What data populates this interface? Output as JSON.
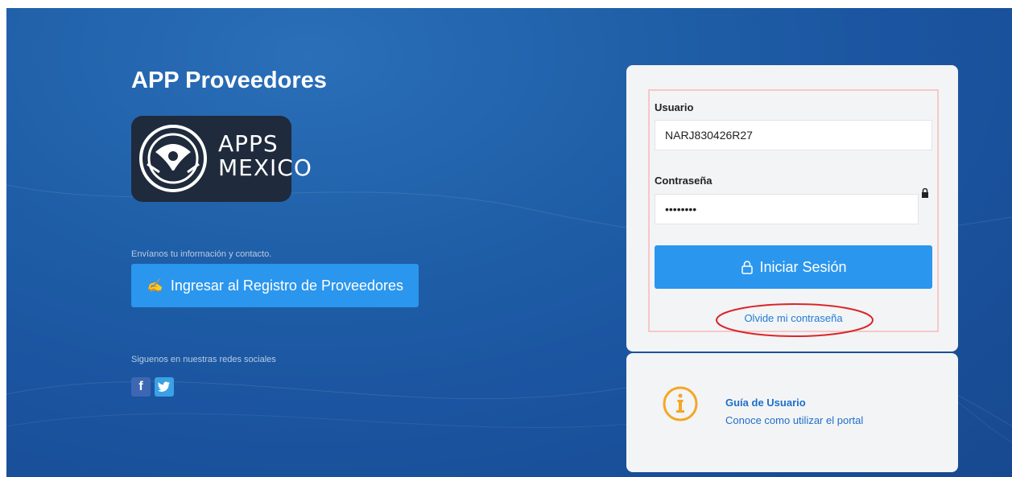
{
  "brand": {
    "app_title": "APP Proveedores",
    "logo_text_line1": "APPS",
    "logo_text_line2": "MEXICO"
  },
  "left": {
    "contact_text": "Envíanos tu información y contacto.",
    "register_button_label": "Ingresar al Registro de Proveedores",
    "social_text": "Siguenos en nuestras redes sociales",
    "social_icons": [
      "facebook-icon",
      "twitter-icon"
    ]
  },
  "login": {
    "user_label": "Usuario",
    "user_value": "NARJ830426R27",
    "password_label": "Contraseña",
    "password_value": "••••••••",
    "submit_label": "Iniciar Sesión",
    "forgot_label": "Olvide mi contraseña"
  },
  "guide": {
    "title": "Guía de Usuario",
    "subtitle": "Conoce como utilizar el portal",
    "icon": "info-icon"
  },
  "colors": {
    "background": "#1f5fa8",
    "primary_button": "#2b96ee",
    "link": "#1e7cd6",
    "info_orange": "#f5a623",
    "highlight_ellipse": "#d9262a"
  }
}
